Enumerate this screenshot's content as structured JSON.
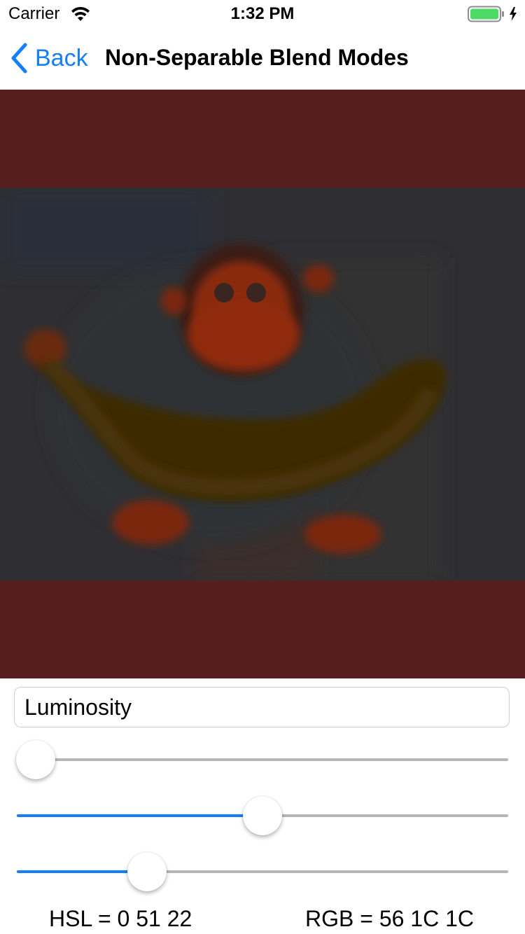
{
  "status_bar": {
    "carrier": "Carrier",
    "time": "1:32 PM",
    "wifi_icon": "wifi-icon",
    "battery_icon": "battery-charging-icon",
    "battery_color": "#4cd964"
  },
  "nav": {
    "back_label": "Back",
    "back_icon": "chevron-left-icon",
    "title": "Non-Separable Blend Modes",
    "accent_color": "#157efb"
  },
  "image": {
    "description_icon": "monkey-with-banana-image",
    "background_color": "#561e1e"
  },
  "blend_mode": {
    "value": "Luminosity"
  },
  "sliders": [
    {
      "name": "hue",
      "value": 0.0
    },
    {
      "name": "saturation",
      "value": 0.5
    },
    {
      "name": "luminance",
      "value": 0.245
    }
  ],
  "readouts": {
    "hsl": "HSL = 0 51 22",
    "rgb": "RGB = 56 1C 1C"
  }
}
